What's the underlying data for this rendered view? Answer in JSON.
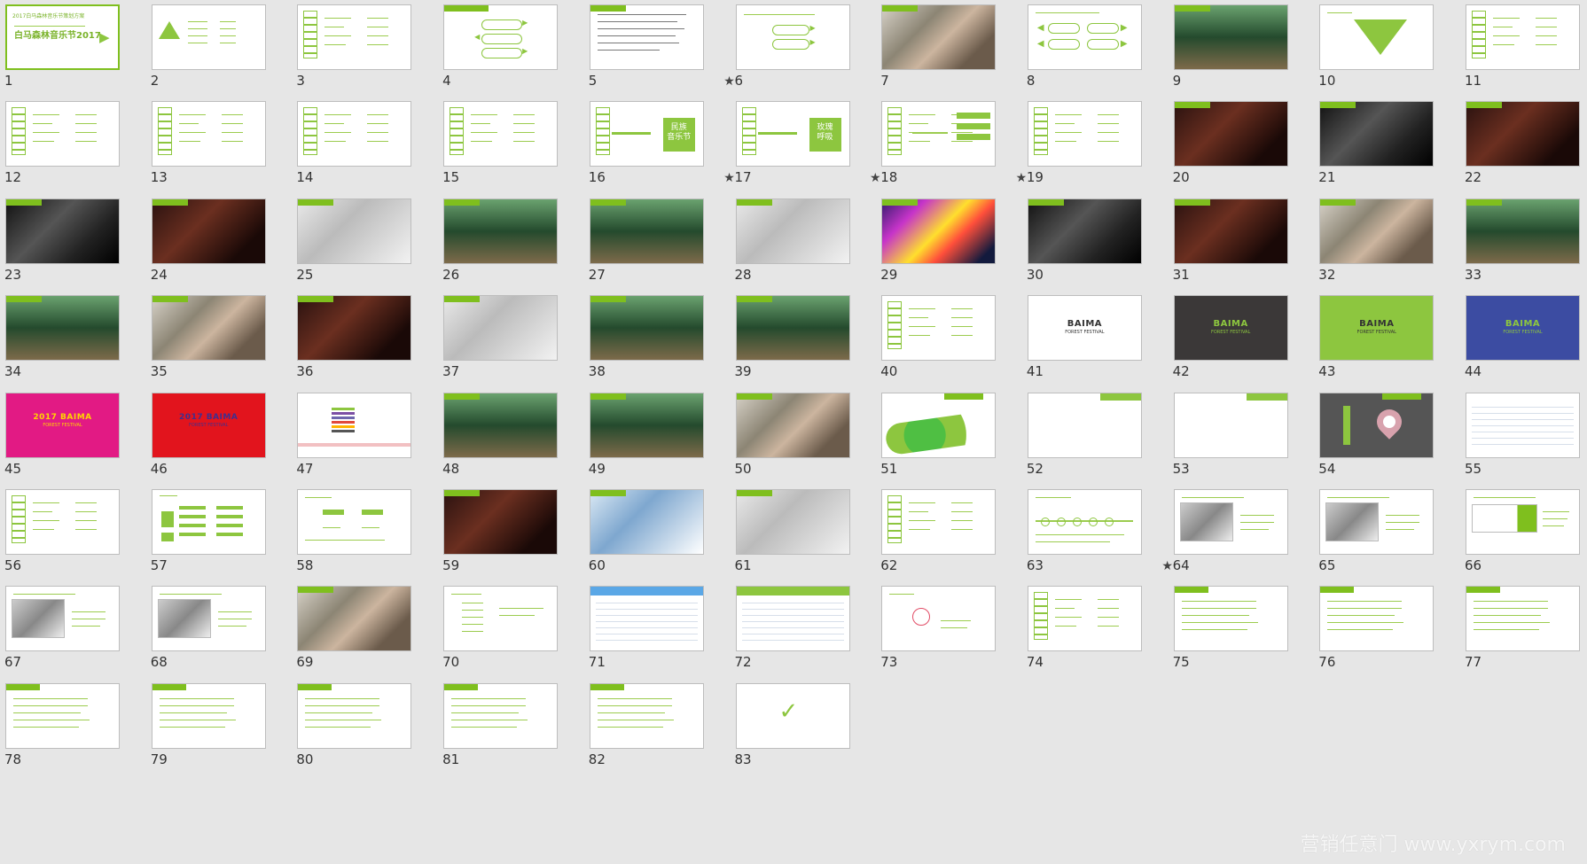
{
  "window": {
    "watermark": "营销任意门 www.yxrym.com"
  },
  "slides": [
    {
      "number": "1",
      "selected": true,
      "star": "",
      "style": "title",
      "title_small": "2017白马森林音乐节策划方案",
      "title_big": "白马森林音乐节2017"
    },
    {
      "number": "2",
      "selected": false,
      "star": "",
      "style": "triangle"
    },
    {
      "number": "3",
      "selected": false,
      "star": "",
      "style": "stack"
    },
    {
      "number": "4",
      "selected": false,
      "star": "",
      "style": "pills"
    },
    {
      "number": "5",
      "selected": false,
      "star": "★",
      "style": "text"
    },
    {
      "number": "6",
      "selected": false,
      "star": "",
      "style": "buttons"
    },
    {
      "number": "7",
      "selected": false,
      "star": "",
      "style": "photo-mixed"
    },
    {
      "number": "8",
      "selected": false,
      "star": "",
      "style": "arrows"
    },
    {
      "number": "9",
      "selected": false,
      "star": "",
      "style": "photo-forest"
    },
    {
      "number": "10",
      "selected": false,
      "star": "",
      "style": "funnel"
    },
    {
      "number": "11",
      "selected": false,
      "star": "",
      "style": "stack"
    },
    {
      "number": "12",
      "selected": false,
      "star": "",
      "style": "stack"
    },
    {
      "number": "13",
      "selected": false,
      "star": "",
      "style": "stack"
    },
    {
      "number": "14",
      "selected": false,
      "star": "",
      "style": "stack"
    },
    {
      "number": "15",
      "selected": false,
      "star": "",
      "style": "stack"
    },
    {
      "number": "16",
      "selected": false,
      "star": "★",
      "style": "panel-text",
      "panel_text": "民族\n音乐节"
    },
    {
      "number": "17",
      "selected": false,
      "star": "★",
      "style": "panel-text",
      "panel_text": "玫瑰\n呼吸"
    },
    {
      "number": "18",
      "selected": false,
      "star": "★",
      "style": "stack-list"
    },
    {
      "number": "19",
      "selected": false,
      "star": "",
      "style": "stack"
    },
    {
      "number": "20",
      "selected": false,
      "star": "",
      "style": "photo-stage"
    },
    {
      "number": "21",
      "selected": false,
      "star": "",
      "style": "photo-dark"
    },
    {
      "number": "22",
      "selected": false,
      "star": "",
      "style": "photo-stage"
    },
    {
      "number": "23",
      "selected": false,
      "star": "",
      "style": "photo-dark"
    },
    {
      "number": "24",
      "selected": false,
      "star": "",
      "style": "photo-stage"
    },
    {
      "number": "25",
      "selected": false,
      "star": "",
      "style": "photo-grey"
    },
    {
      "number": "26",
      "selected": false,
      "star": "",
      "style": "photo-forest"
    },
    {
      "number": "27",
      "selected": false,
      "star": "",
      "style": "photo-forest"
    },
    {
      "number": "28",
      "selected": false,
      "star": "",
      "style": "photo-grey"
    },
    {
      "number": "29",
      "selected": false,
      "star": "",
      "style": "photo-party"
    },
    {
      "number": "30",
      "selected": false,
      "star": "",
      "style": "photo-dark"
    },
    {
      "number": "31",
      "selected": false,
      "star": "",
      "style": "photo-stage"
    },
    {
      "number": "32",
      "selected": false,
      "star": "",
      "style": "photo-mixed"
    },
    {
      "number": "33",
      "selected": false,
      "star": "",
      "style": "photo-forest"
    },
    {
      "number": "34",
      "selected": false,
      "star": "",
      "style": "photo-forest"
    },
    {
      "number": "35",
      "selected": false,
      "star": "",
      "style": "photo-mixed"
    },
    {
      "number": "36",
      "selected": false,
      "star": "",
      "style": "photo-stage"
    },
    {
      "number": "37",
      "selected": false,
      "star": "",
      "style": "photo-grey"
    },
    {
      "number": "38",
      "selected": false,
      "star": "",
      "style": "photo-forest"
    },
    {
      "number": "39",
      "selected": false,
      "star": "",
      "style": "photo-forest"
    },
    {
      "number": "40",
      "selected": false,
      "star": "",
      "style": "stack"
    },
    {
      "number": "41",
      "selected": false,
      "star": "",
      "style": "logo-white",
      "logo": "BAIMA",
      "logo_sub": "FOREST FESTIVAL"
    },
    {
      "number": "42",
      "selected": false,
      "star": "",
      "style": "logo-dark",
      "logo": "BAIMA",
      "logo_sub": "FOREST FESTIVAL"
    },
    {
      "number": "43",
      "selected": false,
      "star": "",
      "style": "logo-green",
      "logo": "BAIMA",
      "logo_sub": "FOREST FESTIVAL"
    },
    {
      "number": "44",
      "selected": false,
      "star": "",
      "style": "logo-blue",
      "logo": "BAIMA",
      "logo_sub": "FOREST FESTIVAL"
    },
    {
      "number": "45",
      "selected": false,
      "star": "",
      "style": "logo-pink",
      "logo": "2017 BAIMA",
      "logo_sub": "FOREST FESTIVAL"
    },
    {
      "number": "46",
      "selected": false,
      "star": "",
      "style": "logo-red",
      "logo": "2017 BAIMA",
      "logo_sub": "FOREST FESTIVAL"
    },
    {
      "number": "47",
      "selected": false,
      "star": "",
      "style": "swatches"
    },
    {
      "number": "48",
      "selected": false,
      "star": "",
      "style": "photo-forest"
    },
    {
      "number": "49",
      "selected": false,
      "star": "",
      "style": "photo-forest"
    },
    {
      "number": "50",
      "selected": false,
      "star": "",
      "style": "photo-mixed"
    },
    {
      "number": "51",
      "selected": false,
      "star": "",
      "style": "map"
    },
    {
      "number": "52",
      "selected": false,
      "star": "",
      "style": "tagged-blank"
    },
    {
      "number": "53",
      "selected": false,
      "star": "",
      "style": "tagged-blank"
    },
    {
      "number": "54",
      "selected": false,
      "star": "",
      "style": "pin"
    },
    {
      "number": "55",
      "selected": false,
      "star": "",
      "style": "table"
    },
    {
      "number": "56",
      "selected": false,
      "star": "",
      "style": "stack"
    },
    {
      "number": "57",
      "selected": false,
      "star": "",
      "style": "blocks"
    },
    {
      "number": "58",
      "selected": false,
      "star": "",
      "style": "blocks-light"
    },
    {
      "number": "59",
      "selected": false,
      "star": "",
      "style": "photo-stage"
    },
    {
      "number": "60",
      "selected": false,
      "star": "",
      "style": "photo-blue"
    },
    {
      "number": "61",
      "selected": false,
      "star": "",
      "style": "photo-grey"
    },
    {
      "number": "62",
      "selected": false,
      "star": "",
      "style": "stack"
    },
    {
      "number": "63",
      "selected": false,
      "star": "★",
      "style": "timeline"
    },
    {
      "number": "64",
      "selected": false,
      "star": "",
      "style": "billboard"
    },
    {
      "number": "65",
      "selected": false,
      "star": "",
      "style": "billboard"
    },
    {
      "number": "66",
      "selected": false,
      "star": "",
      "style": "bus"
    },
    {
      "number": "67",
      "selected": false,
      "star": "",
      "style": "billboard"
    },
    {
      "number": "68",
      "selected": false,
      "star": "",
      "style": "billboard"
    },
    {
      "number": "69",
      "selected": false,
      "star": "",
      "style": "photo-mixed"
    },
    {
      "number": "70",
      "selected": false,
      "star": "",
      "style": "logos"
    },
    {
      "number": "71",
      "selected": false,
      "star": "",
      "style": "table-blue"
    },
    {
      "number": "72",
      "selected": false,
      "star": "",
      "style": "table-green"
    },
    {
      "number": "73",
      "selected": false,
      "star": "",
      "style": "brand-mark"
    },
    {
      "number": "74",
      "selected": false,
      "star": "",
      "style": "stack"
    },
    {
      "number": "75",
      "selected": false,
      "star": "",
      "style": "list"
    },
    {
      "number": "76",
      "selected": false,
      "star": "",
      "style": "list"
    },
    {
      "number": "77",
      "selected": false,
      "star": "",
      "style": "list"
    },
    {
      "number": "78",
      "selected": false,
      "star": "",
      "style": "list"
    },
    {
      "number": "79",
      "selected": false,
      "star": "",
      "style": "list"
    },
    {
      "number": "80",
      "selected": false,
      "star": "",
      "style": "list"
    },
    {
      "number": "81",
      "selected": false,
      "star": "",
      "style": "list"
    },
    {
      "number": "82",
      "selected": false,
      "star": "",
      "style": "list"
    },
    {
      "number": "83",
      "selected": false,
      "star": "",
      "style": "end"
    }
  ]
}
